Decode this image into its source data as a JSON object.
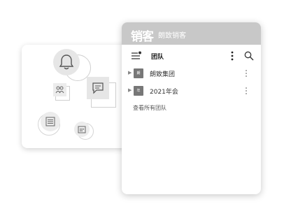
{
  "app": {
    "logo_text": "销客",
    "brand_name": "朗致销客"
  },
  "toolbar": {
    "title": "团队"
  },
  "groups": [
    {
      "avatar_text": "朗",
      "label": "朗致集团"
    },
    {
      "avatar_text": "年",
      "label": "2021年会"
    }
  ],
  "footer": {
    "view_all_label": "查看所有团队"
  },
  "colors": {
    "header_bg": "#c8c8c8",
    "avatar_bg": "#777777"
  },
  "icons": [
    "bell-icon",
    "chat-icon",
    "team-icon",
    "list-icon",
    "calendar-icon",
    "menu-icon",
    "more-icon",
    "search-icon"
  ]
}
